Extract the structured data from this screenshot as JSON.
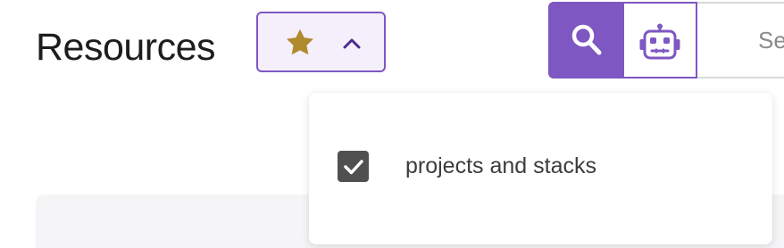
{
  "header": {
    "title": "Resources"
  },
  "favorites_toggle": {
    "star_icon": "star-icon",
    "chevron_icon": "chevron-up-icon",
    "colors": {
      "border": "#7e57c2",
      "background": "#f4effb",
      "star": "#b08a2e",
      "chevron": "#4a2c8a"
    }
  },
  "toolbar": {
    "search_icon": "search-icon",
    "robot_icon": "robot-icon",
    "search_placeholder": "Se",
    "accent_color": "#7e57c2"
  },
  "dropdown": {
    "items": [
      {
        "label": "projects and stacks",
        "checked": true
      }
    ]
  }
}
